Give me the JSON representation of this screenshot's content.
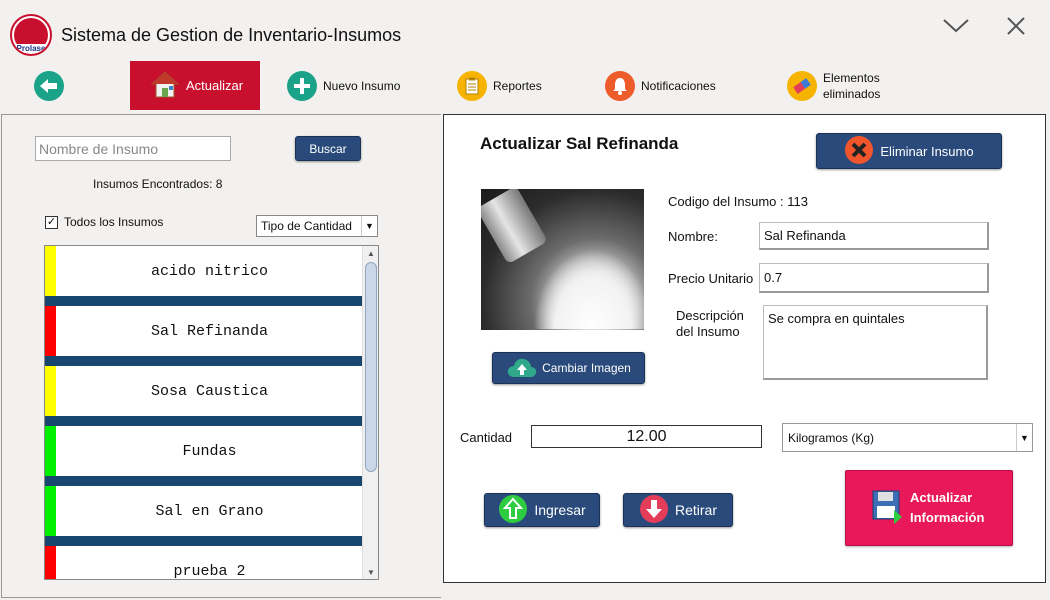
{
  "app": {
    "title": "Sistema de Gestion de Inventario-Insumos",
    "logo_text": "Prolase"
  },
  "toolbar": {
    "actualizar": "Actualizar",
    "nuevo": "Nuevo Insumo",
    "reportes": "Reportes",
    "notificaciones": "Notificaciones",
    "eliminados_line1": "Elementos",
    "eliminados_line2": "eliminados"
  },
  "search": {
    "placeholder": "Nombre de Insumo",
    "button": "Buscar",
    "found": "Insumos Encontrados: 8",
    "all_label": "Todos los Insumos",
    "all_checked": true,
    "filter": "Tipo de Cantidad"
  },
  "list": {
    "items": [
      {
        "name": "acido nitrico",
        "color": "#ffff00"
      },
      {
        "name": "Sal Refinanda",
        "color": "#ff0000"
      },
      {
        "name": "Sosa Caustica",
        "color": "#ffff00"
      },
      {
        "name": "Fundas",
        "color": "#00ee00"
      },
      {
        "name": "Sal en Grano",
        "color": "#00ee00"
      },
      {
        "name": "prueba 2",
        "color": "#ff0000"
      }
    ]
  },
  "detail": {
    "title": "Actualizar Sal Refinanda",
    "delete_button": "Eliminar Insumo",
    "change_image": "Cambiar Imagen",
    "codigo": "Codigo del Insumo : 113",
    "nombre_label": "Nombre:",
    "nombre_value": "Sal Refinanda",
    "precio_label": "Precio Unitario",
    "precio_value": "0.7",
    "desc_label_1": "Descripción",
    "desc_label_2": "del Insumo",
    "desc_value": "Se compra en quintales",
    "cantidad_label": "Cantidad",
    "cantidad_value": "12.00",
    "unit": "Kilogramos (Kg)",
    "ingresar": "Ingresar",
    "retirar": "Retirar",
    "actualizar_line1": "Actualizar",
    "actualizar_line2": "Información"
  },
  "colors": {
    "accent": "#c8102e",
    "button_dark": "#2a4a7c",
    "list_separator": "#17476e",
    "update_button": "#e8185a"
  }
}
